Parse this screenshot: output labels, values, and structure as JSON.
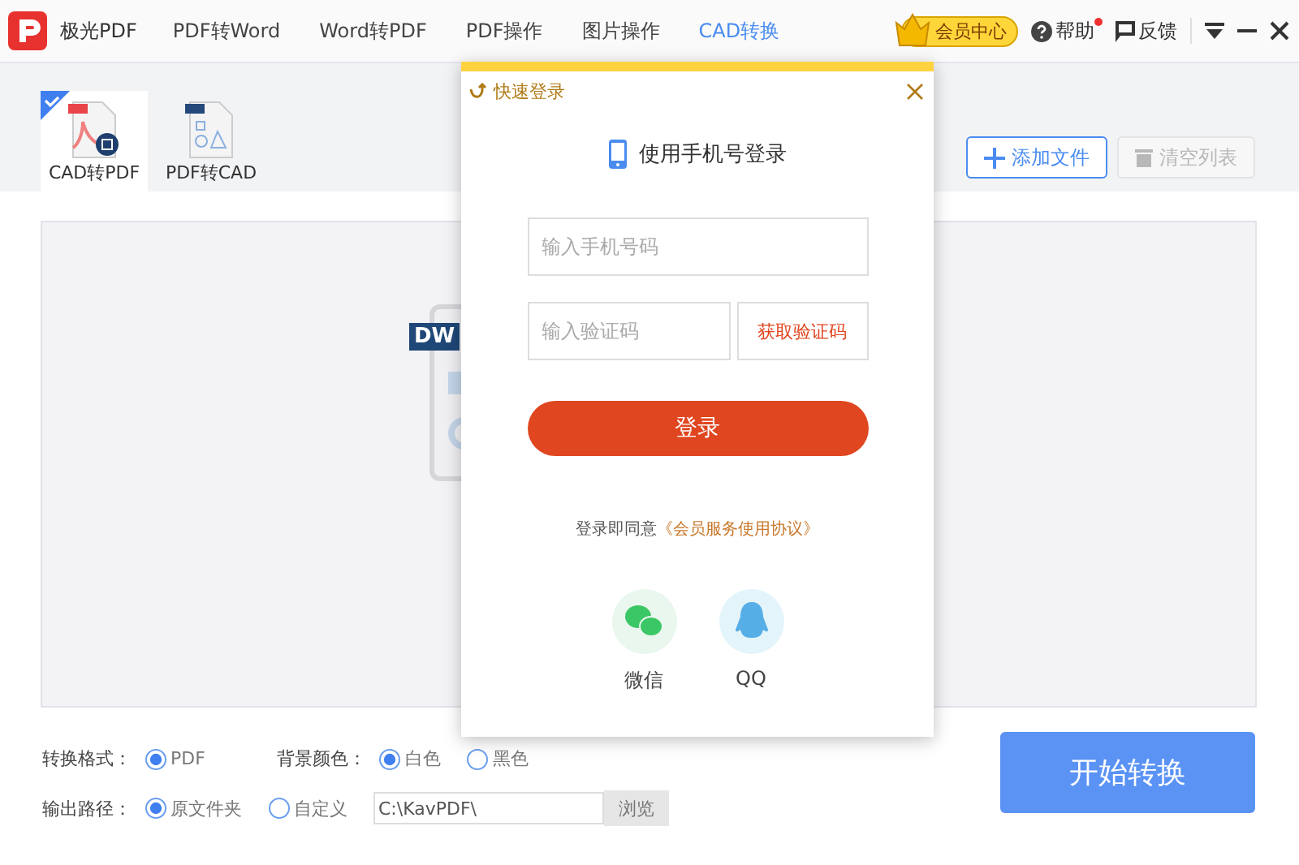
{
  "app_title": "极光PDF",
  "nav_tabs": [
    {
      "label": "PDF转Word",
      "selected": false
    },
    {
      "label": "Word转PDF",
      "selected": false
    },
    {
      "label": "PDF操作",
      "selected": false
    },
    {
      "label": "图片操作",
      "selected": false
    },
    {
      "label": "CAD转换",
      "selected": true
    }
  ],
  "header_actions": {
    "vip": "会员中心",
    "help": "帮助",
    "help_notice": true,
    "feedback": "反馈"
  },
  "tools": [
    {
      "label": "CAD转PDF",
      "kind": "cad2pdf",
      "selected": true
    },
    {
      "label": "PDF转CAD",
      "kind": "pdf2cad",
      "selected": false
    }
  ],
  "toolbar": {
    "add_file": {
      "label": "添加文件",
      "disabled": false
    },
    "clear_list": {
      "label": "清空列表",
      "disabled": true
    }
  },
  "drop_zone": {
    "file_badge": "DW"
  },
  "options": {
    "format": {
      "label": "转换格式：",
      "choices": [
        {
          "label": "PDF",
          "selected": true
        }
      ]
    },
    "background": {
      "label": "背景颜色：",
      "choices": [
        {
          "label": "白色",
          "selected": true
        },
        {
          "label": "黑色",
          "selected": false
        }
      ]
    },
    "output": {
      "label": "输出路径：",
      "choices": [
        {
          "label": "原文件夹",
          "selected": true
        },
        {
          "label": "自定义",
          "selected": false
        }
      ],
      "path": "C:\\KavPDF\\",
      "browse": {
        "label": "浏览",
        "disabled": true
      }
    }
  },
  "start_button": "开始转换",
  "dialog": {
    "title": "快速登录",
    "subtitle": "使用手机号登录",
    "phone_field": {
      "placeholder": "输入手机号码"
    },
    "code_field": {
      "placeholder": "输入验证码"
    },
    "get_code": "获取验证码",
    "login": "登录",
    "agreement": {
      "text": "登录即同意",
      "link": "《会员服务使用协议》"
    },
    "social": [
      {
        "kind": "wechat",
        "label": "微信"
      },
      {
        "kind": "qq",
        "label": "QQ"
      }
    ]
  }
}
